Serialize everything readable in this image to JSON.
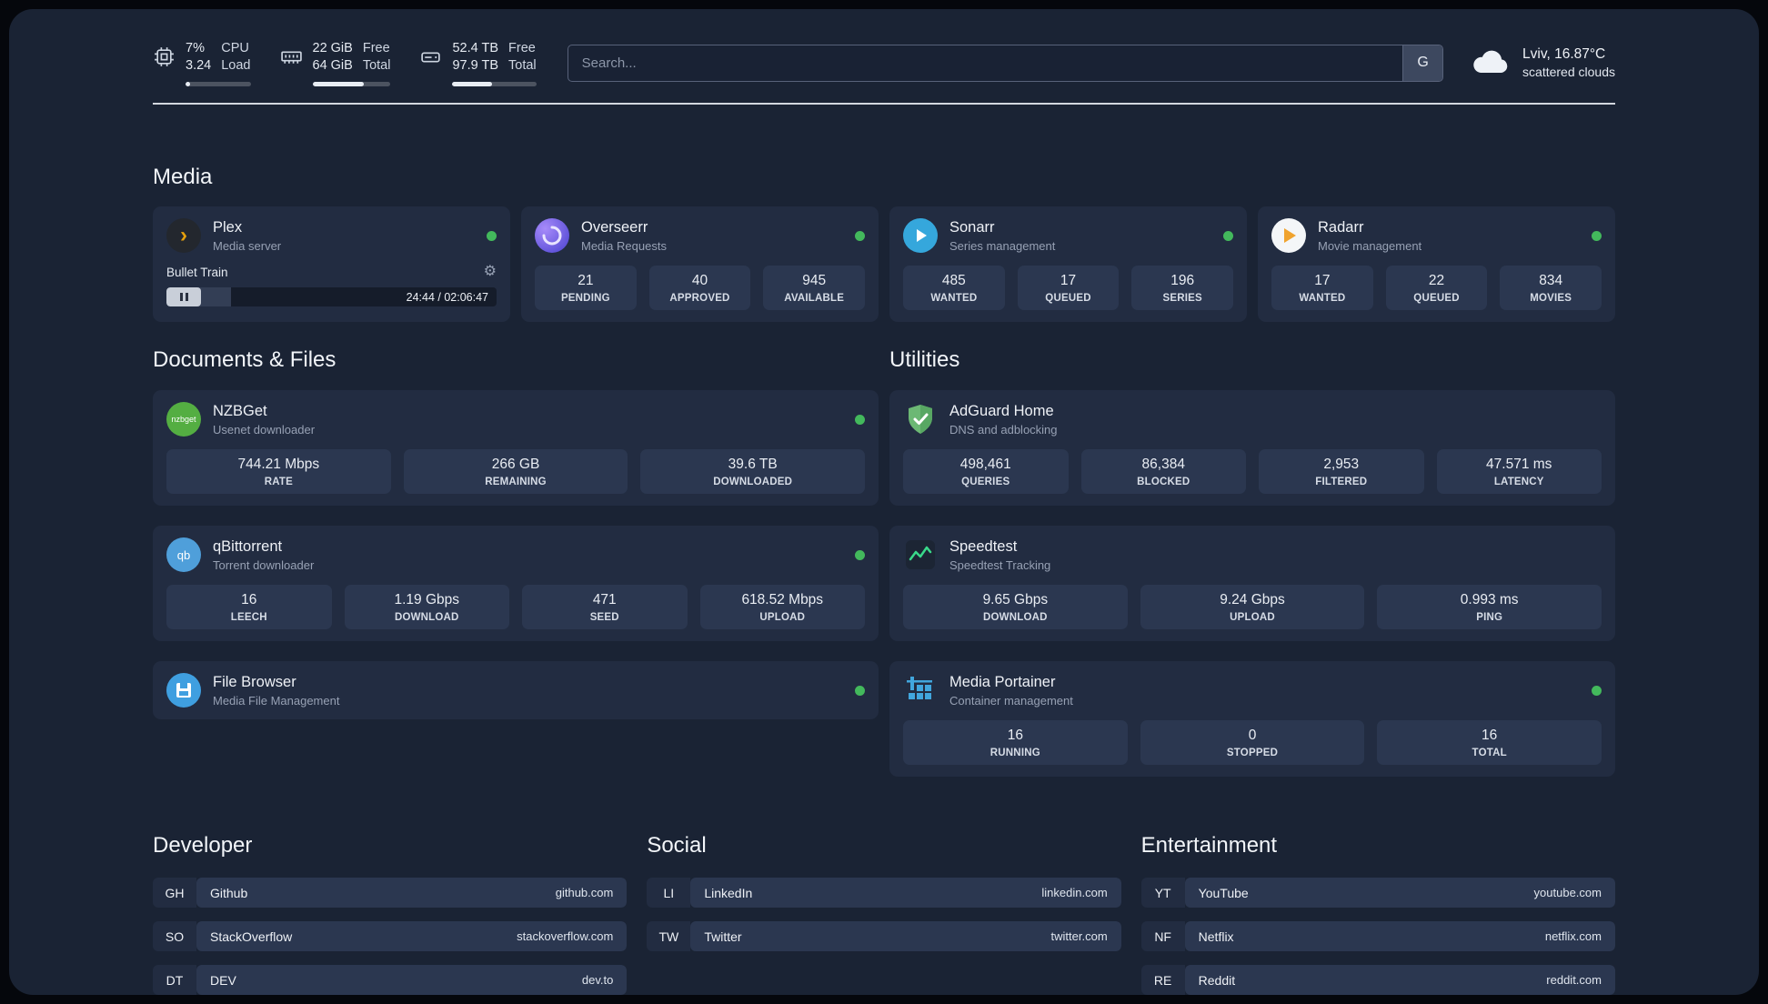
{
  "colors": {
    "background": "#1a2334",
    "card": "#222c41",
    "stat_box": "#2b3750",
    "status_green": "#43b95c",
    "plex_accent": "#e5a00d"
  },
  "icons": {
    "plex_chevron": "›",
    "gear": "⚙",
    "nzbget_text": "nzbget",
    "qb_text": "qb"
  },
  "header": {
    "cpu": {
      "value": "7%",
      "sub": "3.24",
      "label": "CPU",
      "label2": "Load",
      "bar_style": "width:7%"
    },
    "ram": {
      "value": "22 GiB",
      "sub": "64 GiB",
      "label": "Free",
      "label2": "Total",
      "bar_style": "width:66%"
    },
    "disk": {
      "value": "52.4 TB",
      "sub": "97.9 TB",
      "label": "Free",
      "label2": "Total",
      "bar_style": "width:47%"
    },
    "search_placeholder": "Search...",
    "search_button": "G",
    "weather_location": "Lviv, 16.87°C",
    "weather_condition": "scattered clouds"
  },
  "media": {
    "title": "Media",
    "plex": {
      "name": "Plex",
      "subtitle": "Media server",
      "now_playing": "Bullet Train",
      "time": "24:44 / 02:06:47",
      "progress_style": "width:19.5%"
    },
    "overseerr": {
      "name": "Overseerr",
      "subtitle": "Media Requests",
      "stats": [
        {
          "value": "21",
          "label": "PENDING"
        },
        {
          "value": "40",
          "label": "APPROVED"
        },
        {
          "value": "945",
          "label": "AVAILABLE"
        }
      ]
    },
    "sonarr": {
      "name": "Sonarr",
      "subtitle": "Series management",
      "stats": [
        {
          "value": "485",
          "label": "WANTED"
        },
        {
          "value": "17",
          "label": "QUEUED"
        },
        {
          "value": "196",
          "label": "SERIES"
        }
      ]
    },
    "radarr": {
      "name": "Radarr",
      "subtitle": "Movie management",
      "stats": [
        {
          "value": "17",
          "label": "WANTED"
        },
        {
          "value": "22",
          "label": "QUEUED"
        },
        {
          "value": "834",
          "label": "MOVIES"
        }
      ]
    }
  },
  "documents": {
    "title": "Documents & Files",
    "nzbget": {
      "name": "NZBGet",
      "subtitle": "Usenet downloader",
      "stats": [
        {
          "value": "744.21 Mbps",
          "label": "RATE"
        },
        {
          "value": "266 GB",
          "label": "REMAINING"
        },
        {
          "value": "39.6 TB",
          "label": "DOWNLOADED"
        }
      ]
    },
    "qbittorrent": {
      "name": "qBittorrent",
      "subtitle": "Torrent downloader",
      "stats": [
        {
          "value": "16",
          "label": "LEECH"
        },
        {
          "value": "1.19 Gbps",
          "label": "DOWNLOAD"
        },
        {
          "value": "471",
          "label": "SEED"
        },
        {
          "value": "618.52 Mbps",
          "label": "UPLOAD"
        }
      ]
    },
    "filebrowser": {
      "name": "File Browser",
      "subtitle": "Media File Management"
    }
  },
  "utilities": {
    "title": "Utilities",
    "adguard": {
      "name": "AdGuard Home",
      "subtitle": "DNS and adblocking",
      "stats": [
        {
          "value": "498,461",
          "label": "QUERIES"
        },
        {
          "value": "86,384",
          "label": "BLOCKED"
        },
        {
          "value": "2,953",
          "label": "FILTERED"
        },
        {
          "value": "47.571 ms",
          "label": "LATENCY"
        }
      ]
    },
    "speedtest": {
      "name": "Speedtest",
      "subtitle": "Speedtest Tracking",
      "stats": [
        {
          "value": "9.65 Gbps",
          "label": "DOWNLOAD"
        },
        {
          "value": "9.24 Gbps",
          "label": "UPLOAD"
        },
        {
          "value": "0.993 ms",
          "label": "PING"
        }
      ]
    },
    "portainer": {
      "name": "Media Portainer",
      "subtitle": "Container management",
      "stats": [
        {
          "value": "16",
          "label": "RUNNING"
        },
        {
          "value": "0",
          "label": "STOPPED"
        },
        {
          "value": "16",
          "label": "TOTAL"
        }
      ]
    }
  },
  "bookmarks": {
    "developer": {
      "title": "Developer",
      "items": [
        {
          "abbr": "GH",
          "name": "Github",
          "url": "github.com"
        },
        {
          "abbr": "SO",
          "name": "StackOverflow",
          "url": "stackoverflow.com"
        },
        {
          "abbr": "DT",
          "name": "DEV",
          "url": "dev.to"
        }
      ]
    },
    "social": {
      "title": "Social",
      "items": [
        {
          "abbr": "LI",
          "name": "LinkedIn",
          "url": "linkedin.com"
        },
        {
          "abbr": "TW",
          "name": "Twitter",
          "url": "twitter.com"
        }
      ]
    },
    "entertainment": {
      "title": "Entertainment",
      "items": [
        {
          "abbr": "YT",
          "name": "YouTube",
          "url": "youtube.com"
        },
        {
          "abbr": "NF",
          "name": "Netflix",
          "url": "netflix.com"
        },
        {
          "abbr": "RE",
          "name": "Reddit",
          "url": "reddit.com"
        }
      ]
    }
  }
}
